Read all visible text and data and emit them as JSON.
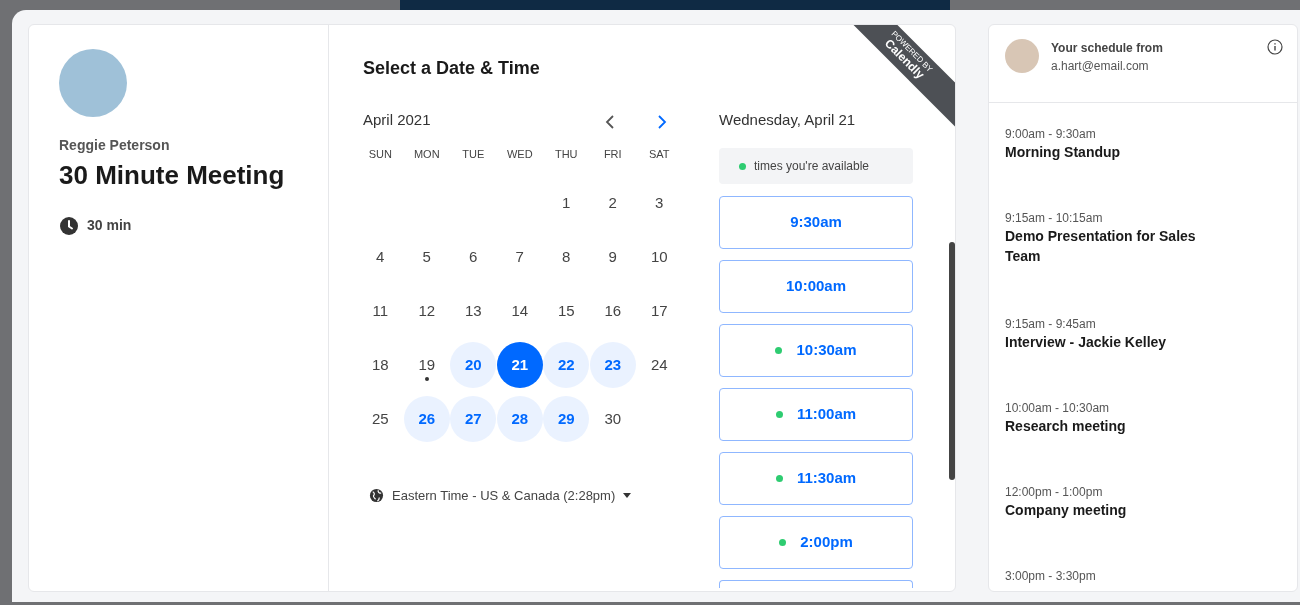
{
  "host": {
    "name": "Reggie Peterson"
  },
  "event": {
    "title": "30 Minute Meeting",
    "duration": "30 min"
  },
  "scheduler": {
    "heading": "Select a Date & Time",
    "badge": {
      "line1": "POWERED BY",
      "line2": "Calendly"
    },
    "month": "April 2021",
    "prev_disabled": true,
    "next_disabled": false,
    "weekdays": [
      "SUN",
      "MON",
      "TUE",
      "WED",
      "THU",
      "FRI",
      "SAT"
    ],
    "weeks": [
      [
        {
          "label": "1",
          "available": false,
          "selected": false,
          "today": false
        },
        {
          "label": "2",
          "available": false,
          "selected": false,
          "today": false
        },
        {
          "label": "3",
          "available": false,
          "selected": false,
          "today": false
        }
      ],
      [
        {
          "label": "4",
          "available": false,
          "selected": false,
          "today": false
        },
        {
          "label": "5",
          "available": false,
          "selected": false,
          "today": false
        },
        {
          "label": "6",
          "available": false,
          "selected": false,
          "today": false
        },
        {
          "label": "7",
          "available": false,
          "selected": false,
          "today": false
        },
        {
          "label": "8",
          "available": false,
          "selected": false,
          "today": false
        },
        {
          "label": "9",
          "available": false,
          "selected": false,
          "today": false
        },
        {
          "label": "10",
          "available": false,
          "selected": false,
          "today": false
        }
      ],
      [
        {
          "label": "11",
          "available": false,
          "selected": false,
          "today": false
        },
        {
          "label": "12",
          "available": false,
          "selected": false,
          "today": false
        },
        {
          "label": "13",
          "available": false,
          "selected": false,
          "today": false
        },
        {
          "label": "14",
          "available": false,
          "selected": false,
          "today": false
        },
        {
          "label": "15",
          "available": false,
          "selected": false,
          "today": false
        },
        {
          "label": "16",
          "available": false,
          "selected": false,
          "today": false
        },
        {
          "label": "17",
          "available": false,
          "selected": false,
          "today": false
        }
      ],
      [
        {
          "label": "18",
          "available": false,
          "selected": false,
          "today": false
        },
        {
          "label": "19",
          "available": false,
          "selected": false,
          "today": true
        },
        {
          "label": "20",
          "available": true,
          "selected": false,
          "today": false
        },
        {
          "label": "21",
          "available": true,
          "selected": true,
          "today": false
        },
        {
          "label": "22",
          "available": true,
          "selected": false,
          "today": false
        },
        {
          "label": "23",
          "available": true,
          "selected": false,
          "today": false
        },
        {
          "label": "24",
          "available": false,
          "selected": false,
          "today": false
        }
      ],
      [
        {
          "label": "25",
          "available": false,
          "selected": false,
          "today": false
        },
        {
          "label": "26",
          "available": true,
          "selected": false,
          "today": false
        },
        {
          "label": "27",
          "available": true,
          "selected": false,
          "today": false
        },
        {
          "label": "28",
          "available": true,
          "selected": false,
          "today": false
        },
        {
          "label": "29",
          "available": true,
          "selected": false,
          "today": false
        },
        {
          "label": "30",
          "available": false,
          "selected": false,
          "today": false
        }
      ]
    ],
    "timezone": "Eastern Time - US & Canada (2:28pm)",
    "date_heading": "Wednesday, April 21",
    "legend": "times you're available",
    "slots": [
      {
        "time": "9:30am",
        "available": false
      },
      {
        "time": "10:00am",
        "available": false
      },
      {
        "time": "10:30am",
        "available": true
      },
      {
        "time": "11:00am",
        "available": true
      },
      {
        "time": "11:30am",
        "available": true
      },
      {
        "time": "2:00pm",
        "available": true
      }
    ]
  },
  "schedule": {
    "title": "Your schedule from",
    "email": "a.hart@email.com",
    "events": [
      {
        "time": "9:00am - 9:30am",
        "title": "Morning Standup"
      },
      {
        "time": "9:15am - 10:15am",
        "title": "Demo Presentation for Sales Team"
      },
      {
        "time": "9:15am - 9:45am",
        "title": "Interview - Jackie Kelley"
      },
      {
        "time": "10:00am - 10:30am",
        "title": "Research meeting"
      },
      {
        "time": "12:00pm - 1:00pm",
        "title": "Company meeting"
      },
      {
        "time": "3:00pm - 3:30pm"
      }
    ]
  }
}
